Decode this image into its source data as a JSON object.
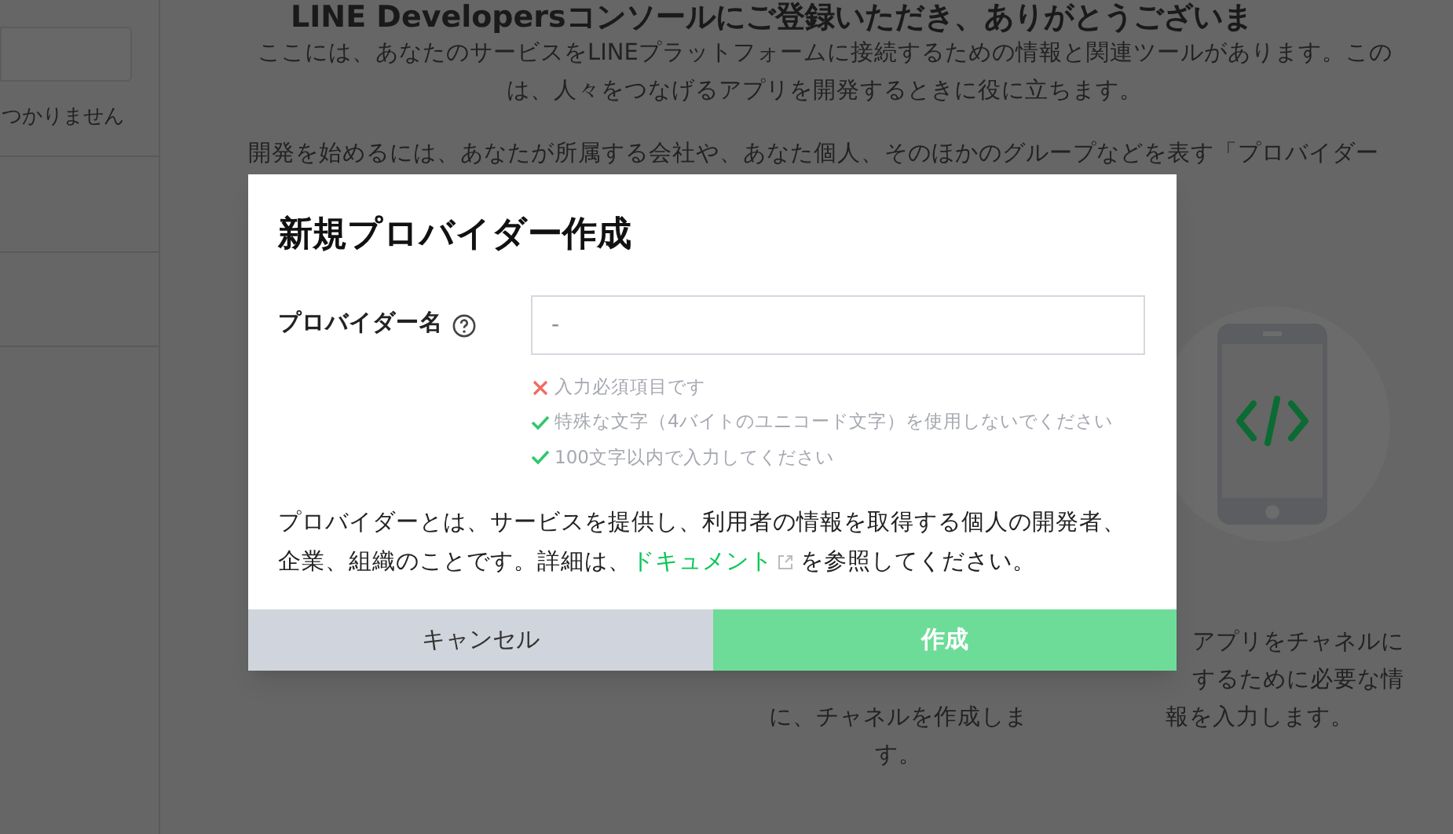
{
  "sidebar": {
    "message": "つかりません"
  },
  "page": {
    "heading": "LINE Developersコンソールにご登録いただき、ありがとうございま",
    "intro_lines": [
      "ここには、あなたのサービスをLINEプラットフォームに接続するための情報と関連ツールがあります。この",
      "は、人々をつなげるアプリを開発するときに役に立ちます。"
    ],
    "lead": "開発を始めるには、あなたが所属する会社や、あなた個人、そのほかのグループなどを表す「プロバイダー",
    "steps": [
      {
        "lines": [
          "に、チャネルを作成しま",
          "す。"
        ],
        "illustration": false
      },
      {
        "lines": [
          "アプリをチャネルに",
          "するために必要な情",
          "報を入力します。"
        ],
        "illustration": true
      }
    ]
  },
  "dialog": {
    "title": "新規プロバイダー作成",
    "field_label": "プロバイダー名",
    "placeholder": "-",
    "rules": [
      {
        "text": "入力必須項目です",
        "met": false
      },
      {
        "text": "特殊な文字（4バイトのユニコード文字）を使用しないでください",
        "met": true
      },
      {
        "text": "100文字以内で入力してください",
        "met": true
      }
    ],
    "description_before": "プロバイダーとは、サービスを提供し、利用者の情報を取得する個人の開発者、企業、組織のことです。詳細は、",
    "link": "ドキュメント",
    "description_after": "を参照してください。",
    "buttons": [
      {
        "label": "キャンセル",
        "kind": "secondary"
      },
      {
        "label": "作成",
        "kind": "primary"
      }
    ]
  }
}
